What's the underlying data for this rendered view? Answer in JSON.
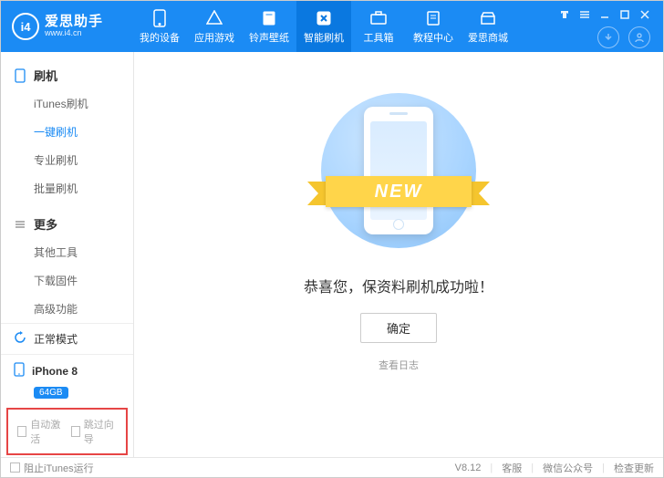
{
  "brand": {
    "name": "爱思助手",
    "url": "www.i4.cn",
    "logo_text": "i4"
  },
  "nav": [
    {
      "label": "我的设备",
      "icon": "phone"
    },
    {
      "label": "应用游戏",
      "icon": "apps"
    },
    {
      "label": "铃声壁纸",
      "icon": "music"
    },
    {
      "label": "智能刷机",
      "icon": "chip",
      "active": true
    },
    {
      "label": "工具箱",
      "icon": "toolbox"
    },
    {
      "label": "教程中心",
      "icon": "note"
    },
    {
      "label": "爱思商城",
      "icon": "store"
    }
  ],
  "sidebar": {
    "groups": [
      {
        "title": "刷机",
        "icon": "phone-outline",
        "items": [
          "iTunes刷机",
          "一键刷机",
          "专业刷机",
          "批量刷机"
        ],
        "active_index": 1
      },
      {
        "title": "更多",
        "icon": "menu",
        "items": [
          "其他工具",
          "下载固件",
          "高级功能"
        ],
        "active_index": -1
      }
    ],
    "mode": {
      "label": "正常模式"
    },
    "device": {
      "name": "iPhone 8",
      "storage": "64GB"
    },
    "bottom_checks": [
      {
        "label": "自动激活",
        "checked": false
      },
      {
        "label": "跳过向导",
        "checked": false
      }
    ]
  },
  "main": {
    "ribbon_text": "NEW",
    "success_text": "恭喜您，保资料刷机成功啦！",
    "ok_label": "确定",
    "log_link": "查看日志"
  },
  "status": {
    "block_itunes": "阻止iTunes运行",
    "version": "V8.12",
    "links": [
      "客服",
      "微信公众号",
      "检查更新"
    ]
  }
}
